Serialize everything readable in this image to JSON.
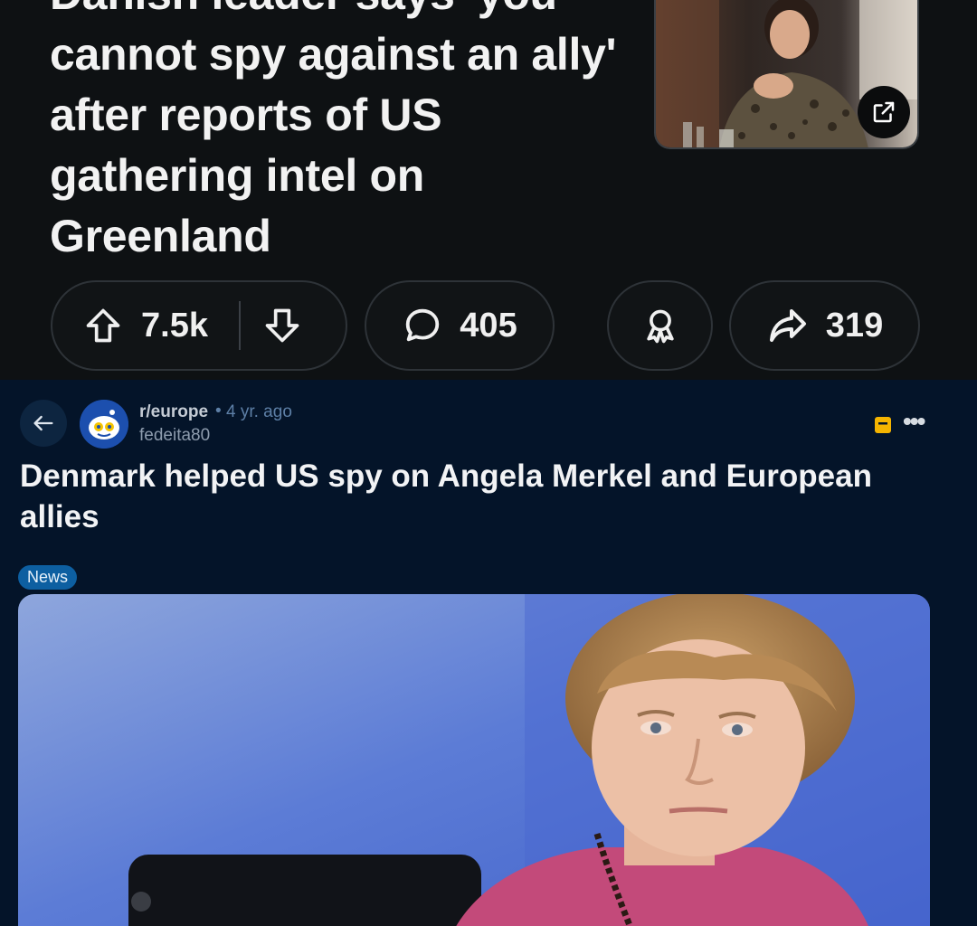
{
  "top_post": {
    "title": "Danish leader says 'you cannot spy against an ally' after reports of US gathering intel on Greenland",
    "actions": {
      "upvotes": "7.5k",
      "comments": "405",
      "shares": "319"
    }
  },
  "bottom_post": {
    "subreddit": "r/europe",
    "separator": "•",
    "age": "4 yr. ago",
    "username": "fedeita80",
    "title": "Denmark helped US spy on Angela Merkel and European allies",
    "flair": "News"
  },
  "colors": {
    "top_background": "#0e1113",
    "bottom_background": "#041429",
    "flair_background": "#0d5fa1",
    "save_icon": "#f5b400"
  },
  "icons": [
    "upvote-icon",
    "downvote-icon",
    "comment-icon",
    "award-icon",
    "share-icon",
    "external-link-icon",
    "back-arrow-icon",
    "save-icon",
    "more-icon"
  ]
}
